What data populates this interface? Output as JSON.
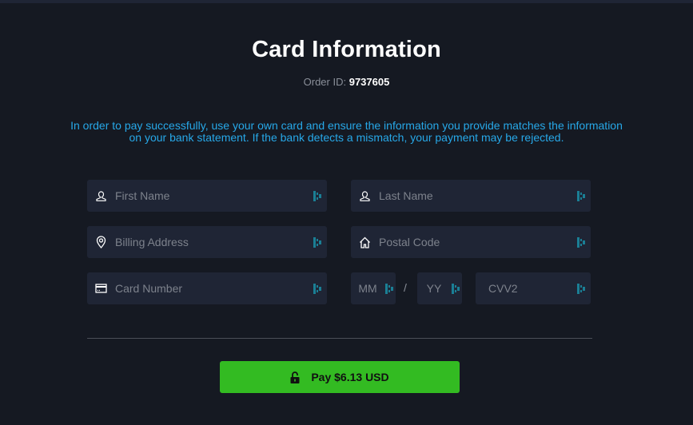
{
  "header": {
    "title": "Card Information",
    "order_label": "Order ID: ",
    "order_id": "9737605"
  },
  "notice": {
    "line1": "In order to pay successfully, use your own card and ensure the information you provide matches the information",
    "line2": "on your bank statement. If the bank detects a mismatch, your payment may be rejected.",
    "color": "#27a8e8"
  },
  "form": {
    "first_name": {
      "placeholder": "First Name",
      "value": "",
      "icon": "user-icon"
    },
    "last_name": {
      "placeholder": "Last Name",
      "value": "",
      "icon": "user-icon"
    },
    "billing_address": {
      "placeholder": "Billing Address",
      "value": "",
      "icon": "map-pin-icon"
    },
    "postal_code": {
      "placeholder": "Postal Code",
      "value": "",
      "icon": "home-icon"
    },
    "card_number": {
      "placeholder": "Card Number",
      "value": "",
      "icon": "credit-card-icon"
    },
    "exp_month": {
      "placeholder": "MM",
      "value": ""
    },
    "exp_separator": "/",
    "exp_year": {
      "placeholder": "YY",
      "value": ""
    },
    "cvv": {
      "placeholder": "CVV2",
      "value": ""
    }
  },
  "pay_button": {
    "label": "Pay $6.13 USD",
    "icon": "lock-open-icon",
    "color": "#33bb22"
  }
}
